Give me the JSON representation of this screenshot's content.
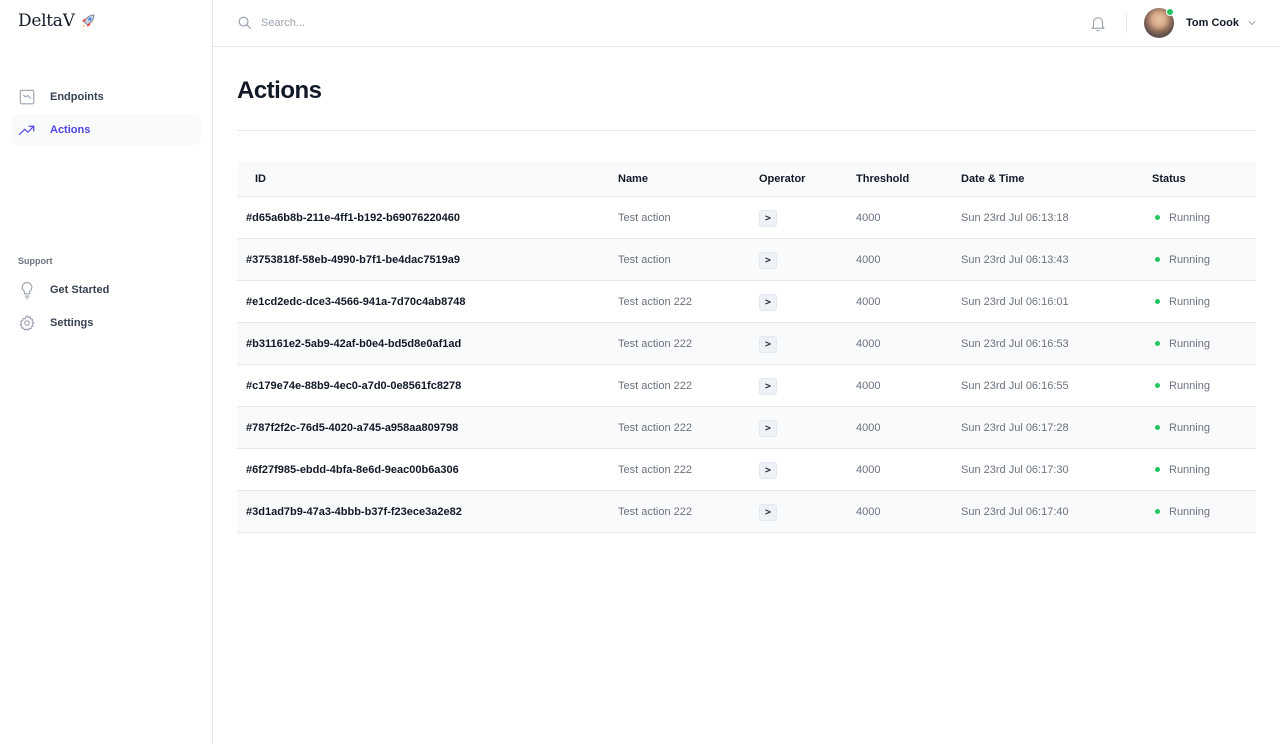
{
  "brand": {
    "name": "DeltaV",
    "rocket_icon": "rocket-icon"
  },
  "sidebar": {
    "items": [
      {
        "label": "Endpoints",
        "icon": "chart-box-icon",
        "active": false
      },
      {
        "label": "Actions",
        "icon": "trending-up-icon",
        "active": true
      }
    ],
    "support_heading": "Support",
    "support_items": [
      {
        "label": "Get Started",
        "icon": "lightbulb-icon"
      },
      {
        "label": "Settings",
        "icon": "gear-icon"
      }
    ]
  },
  "header": {
    "search": {
      "placeholder": "Search...",
      "value": ""
    },
    "user": {
      "name": "Tom Cook",
      "online": true
    }
  },
  "main": {
    "title": "Actions",
    "table": {
      "columns": [
        "ID",
        "Name",
        "Operator",
        "Threshold",
        "Date & Time",
        "Status"
      ],
      "rows": [
        {
          "id": "#d65a6b8b-211e-4ff1-b192-b69076220460",
          "name": "Test action",
          "operator": ">",
          "threshold": "4000",
          "datetime": "Sun 23rd Jul 06:13:18",
          "status": "Running"
        },
        {
          "id": "#3753818f-58eb-4990-b7f1-be4dac7519a9",
          "name": "Test action",
          "operator": ">",
          "threshold": "4000",
          "datetime": "Sun 23rd Jul 06:13:43",
          "status": "Running"
        },
        {
          "id": "#e1cd2edc-dce3-4566-941a-7d70c4ab8748",
          "name": "Test action 222",
          "operator": ">",
          "threshold": "4000",
          "datetime": "Sun 23rd Jul 06:16:01",
          "status": "Running"
        },
        {
          "id": "#b31161e2-5ab9-42af-b0e4-bd5d8e0af1ad",
          "name": "Test action 222",
          "operator": ">",
          "threshold": "4000",
          "datetime": "Sun 23rd Jul 06:16:53",
          "status": "Running"
        },
        {
          "id": "#c179e74e-88b9-4ec0-a7d0-0e8561fc8278",
          "name": "Test action 222",
          "operator": ">",
          "threshold": "4000",
          "datetime": "Sun 23rd Jul 06:16:55",
          "status": "Running"
        },
        {
          "id": "#787f2f2c-76d5-4020-a745-a958aa809798",
          "name": "Test action 222",
          "operator": ">",
          "threshold": "4000",
          "datetime": "Sun 23rd Jul 06:17:28",
          "status": "Running"
        },
        {
          "id": "#6f27f985-ebdd-4bfa-8e6d-9eac00b6a306",
          "name": "Test action 222",
          "operator": ">",
          "threshold": "4000",
          "datetime": "Sun 23rd Jul 06:17:30",
          "status": "Running"
        },
        {
          "id": "#3d1ad7b9-47a3-4bbb-b37f-f23ece3a2e82",
          "name": "Test action 222",
          "operator": ">",
          "threshold": "4000",
          "datetime": "Sun 23rd Jul 06:17:40",
          "status": "Running"
        }
      ]
    }
  },
  "colors": {
    "accent": "#4f46e5",
    "status_running": "#22c55e",
    "border": "#e5e7eb",
    "row_alt": "#f9fafb"
  }
}
